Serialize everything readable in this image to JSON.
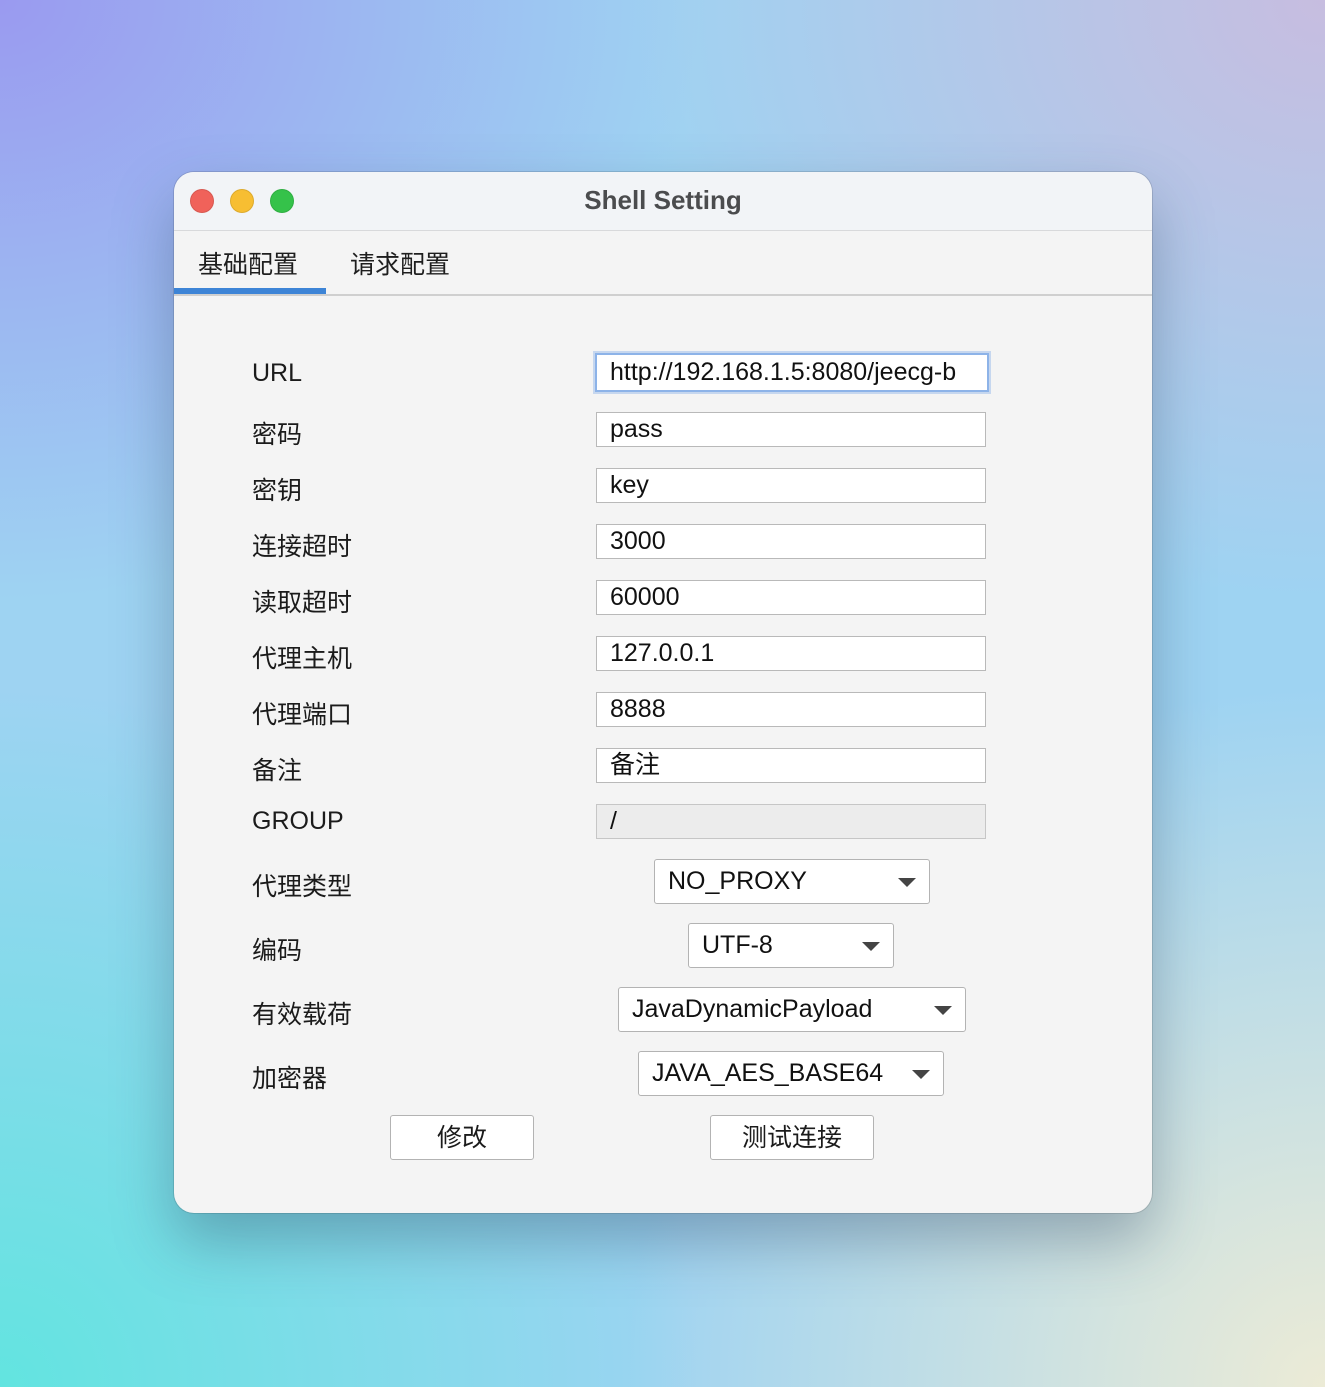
{
  "window": {
    "title": "Shell Setting"
  },
  "tabs": [
    {
      "label": "基础配置",
      "active": true
    },
    {
      "label": "请求配置",
      "active": false
    }
  ],
  "form": {
    "fields": [
      {
        "label": "URL",
        "value": "http://192.168.1.5:8080/jeecg-b"
      },
      {
        "label": "密码",
        "value": "pass"
      },
      {
        "label": "密钥",
        "value": "key"
      },
      {
        "label": "连接超时",
        "value": "3000"
      },
      {
        "label": "读取超时",
        "value": "60000"
      },
      {
        "label": "代理主机",
        "value": "127.0.0.1"
      },
      {
        "label": "代理端口",
        "value": "8888"
      },
      {
        "label": "备注",
        "value": "备注"
      },
      {
        "label": "GROUP",
        "value": "/",
        "disabled": true
      }
    ],
    "selects": [
      {
        "label": "代理类型",
        "value": "NO_PROXY"
      },
      {
        "label": "编码",
        "value": "UTF-8"
      },
      {
        "label": "有效载荷",
        "value": "JavaDynamicPayload"
      },
      {
        "label": "加密器",
        "value": "JAVA_AES_BASE64"
      }
    ]
  },
  "buttons": {
    "modify": "修改",
    "test_connection": "测试连接"
  },
  "colors": {
    "tab_accent": "#3d84d6",
    "focus_ring": "#8db3e8",
    "close": "#f0625a",
    "minimize": "#f7be32",
    "maximize": "#35c24a"
  }
}
